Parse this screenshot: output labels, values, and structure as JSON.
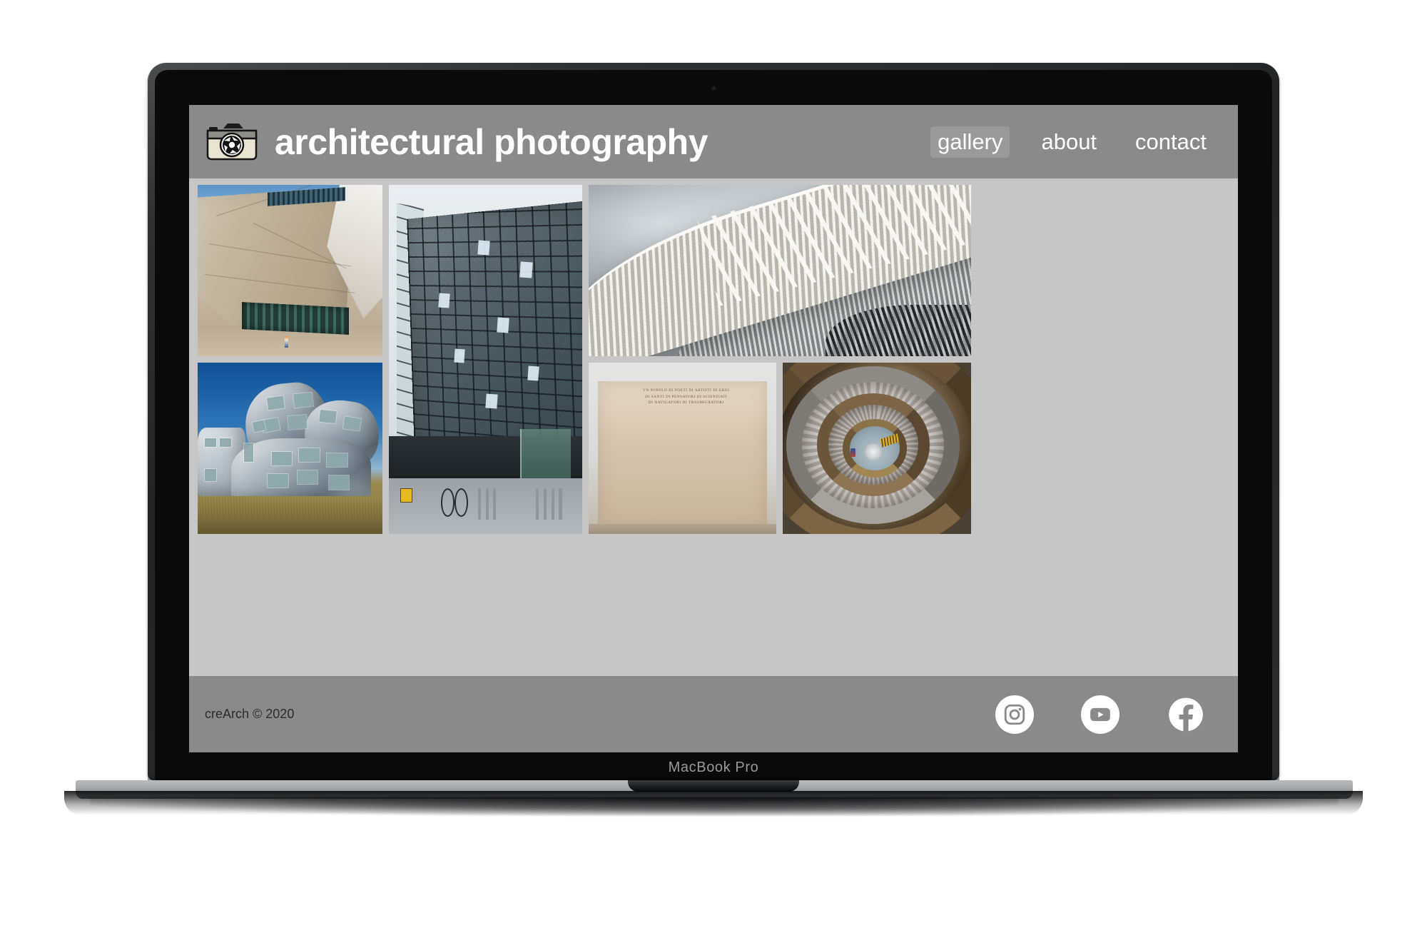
{
  "device": {
    "model_label": "MacBook Pro",
    "kind": "laptop-mockup"
  },
  "site": {
    "header": {
      "logo_icon": "camera-icon",
      "title": "architectural photography",
      "nav": [
        {
          "label": "gallery",
          "active": true
        },
        {
          "label": "about",
          "active": false
        },
        {
          "label": "contact",
          "active": false
        }
      ]
    },
    "gallery": {
      "background": "#c6c6c6",
      "tiles": [
        {
          "id": "casa-da-musica",
          "alt": "Angular concrete faceted concert hall against blue sky with a lone pedestrian"
        },
        {
          "id": "harpa-concert-hall",
          "alt": "Honeycomb glass facade tower with plaza, bicycle and bike racks below"
        },
        {
          "id": "liege-guillemins-station",
          "alt": "White louvered steel canopy vaults sweeping across a stormy sky"
        },
        {
          "id": "lou-ruvo-center",
          "alt": "Crumpled stainless steel Gehry building above dry golden grass"
        },
        {
          "id": "palazzo-della-civilta-italiana",
          "alt": "Travertine arcade block inscribed with a Latin-style dedication"
        },
        {
          "id": "bramante-spiral-staircase",
          "alt": "Double-helix spiral staircase seen from above with a single visitor"
        }
      ]
    },
    "palazzo_inscription": "VN POPOLO DI POETI DI ARTISTI DI EROI\nDI SANTI DI PENSATORI DI SCIENZIATI\nDI NAVIGATORI DI TRASMIGRATORI",
    "footer": {
      "copyright": "creArch © 2020",
      "socials": [
        {
          "name": "instagram",
          "icon": "instagram-icon"
        },
        {
          "name": "youtube",
          "icon": "youtube-icon"
        },
        {
          "name": "facebook",
          "icon": "facebook-icon"
        }
      ]
    }
  },
  "colors": {
    "chrome_gray": "#8a8a8a",
    "gallery_gray": "#c6c6c6",
    "title_white": "#ffffff",
    "copyright_dark": "#2c2c2c",
    "lid_dark": "#2a2c2e",
    "base_silver": "#a7a9ab"
  }
}
